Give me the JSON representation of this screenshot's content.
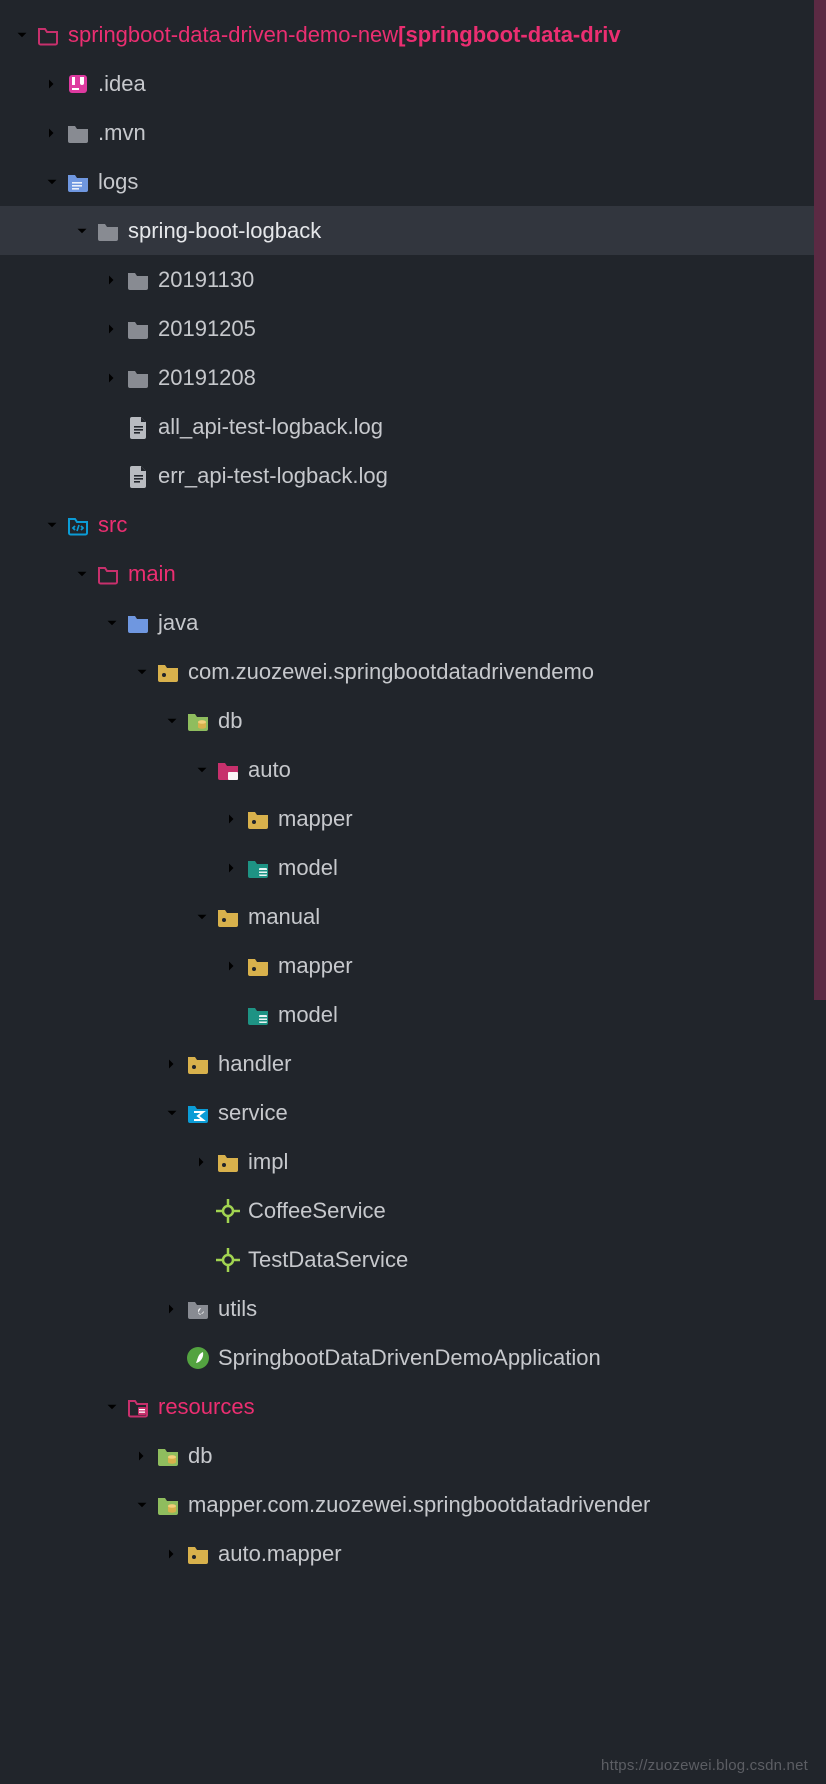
{
  "watermark": "https://zuozewei.blog.csdn.net",
  "root": {
    "name": "springboot-data-driven-demo-new",
    "branch": " [springboot-data-driv"
  },
  "tree": {
    "idea": ".idea",
    "mvn": ".mvn",
    "logs": "logs",
    "sbl": "spring-boot-logback",
    "d1": "20191130",
    "d2": "20191205",
    "d3": "20191208",
    "log1": "all_api-test-logback.log",
    "log2": "err_api-test-logback.log",
    "src": "src",
    "main": "main",
    "java": "java",
    "pkg": "com.zuozewei.springbootdatadrivendemo",
    "db": "db",
    "auto": "auto",
    "mapper1": "mapper",
    "model1": "model",
    "manual": "manual",
    "mapper2": "mapper",
    "model2": "model",
    "handler": "handler",
    "service": "service",
    "impl": "impl",
    "coffee": "CoffeeService",
    "testdata": "TestDataService",
    "utils": "utils",
    "app": "SpringbootDataDrivenDemoApplication",
    "resources": "resources",
    "rdb": "db",
    "mapperpkg": "mapper.com.zuozewei.springbootdatadrivender",
    "automapper": "auto.mapper"
  }
}
